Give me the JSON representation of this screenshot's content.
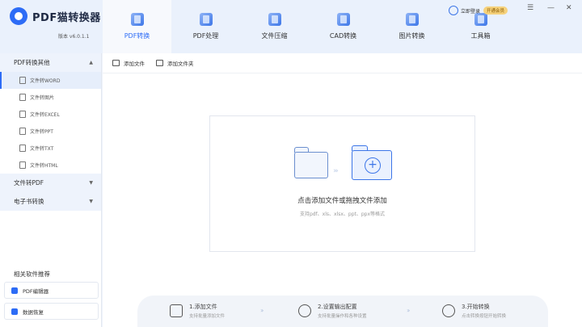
{
  "app": {
    "title": "PDF猫转换器",
    "version": "版本 v6.0.1.1"
  },
  "header": {
    "tabs": [
      {
        "label": "PDF转换",
        "icon": "pdf-convert-icon"
      },
      {
        "label": "PDF处理",
        "icon": "pdf-process-icon"
      },
      {
        "label": "文件压缩",
        "icon": "compress-icon"
      },
      {
        "label": "CAD转换",
        "icon": "cad-icon"
      },
      {
        "label": "图片转换",
        "icon": "image-icon"
      },
      {
        "label": "工具箱",
        "icon": "toolbox-icon"
      }
    ],
    "login": "立即登录",
    "vip": "开通会员"
  },
  "sidebar": {
    "groups": [
      {
        "label": "PDF转换其他",
        "items": [
          "文件转WORD",
          "文件转图片",
          "文件转EXCEL",
          "文件转PPT",
          "文件转TXT",
          "文件转HTML"
        ]
      },
      {
        "label": "文件转PDF"
      },
      {
        "label": "电子书转换"
      }
    ],
    "recommend_title": "相关软件推荐",
    "recommend": [
      "PDF编辑器",
      "数据恢复"
    ]
  },
  "toolbar": {
    "add_file": "添加文件",
    "add_folder": "添加文件夹"
  },
  "dropzone": {
    "title": "点击添加文件或拖拽文件添加",
    "subtitle": "支持pdf、xls、xlsx、ppt、ppx等格式"
  },
  "steps": [
    {
      "title": "1.添加文件",
      "desc": "支持批量添加文件"
    },
    {
      "title": "2.设置输出配置",
      "desc": "支持批量操作和各种设置"
    },
    {
      "title": "3.开始转换",
      "desc": "点击转换按钮开始转换"
    }
  ],
  "colors": {
    "accent": "#2d6cf6",
    "header_bg": "#eaf1fc"
  }
}
